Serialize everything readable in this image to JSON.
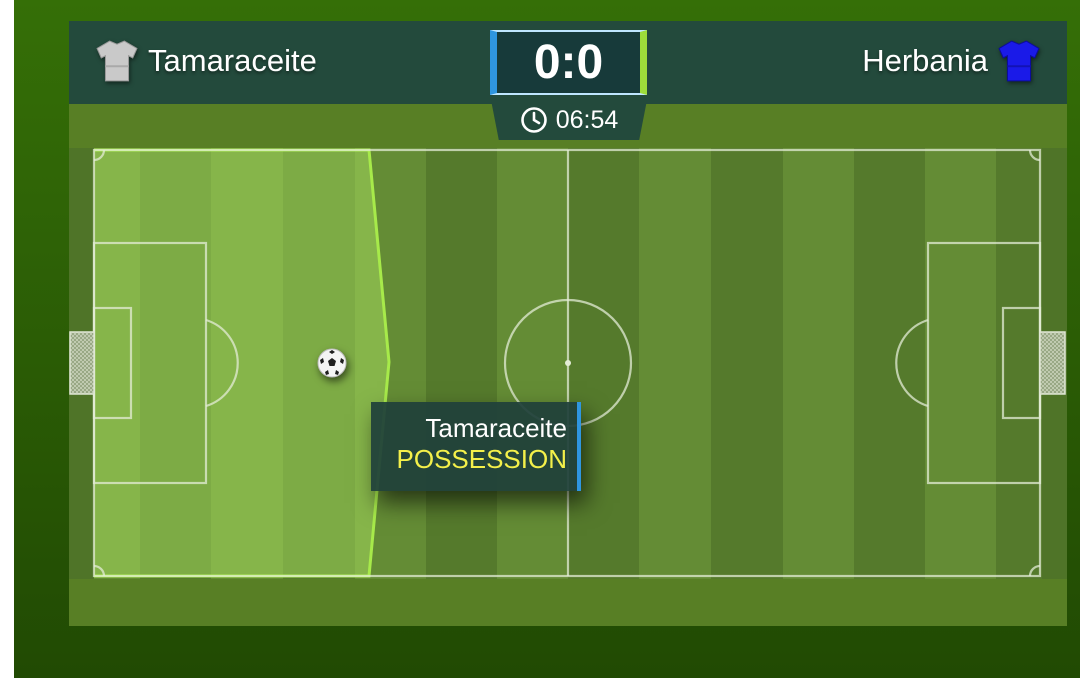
{
  "scoreboard": {
    "home_team": "Tamaraceite",
    "away_team": "Herbania",
    "score": "0:0",
    "clock": "06:54"
  },
  "icons": {
    "home_shirt": "shirt-icon",
    "away_shirt": "shirt-icon",
    "clock": "clock-icon",
    "ball": "soccer-ball-icon"
  },
  "colors": {
    "home_kit": "#c9c9c9",
    "away_kit": "#1a1ae8",
    "home_accent": "#2f96e0",
    "away_accent": "#9ddd3a",
    "status_text": "#f4f04a"
  },
  "event": {
    "team": "Tamaraceite",
    "label": "POSSESSION"
  }
}
